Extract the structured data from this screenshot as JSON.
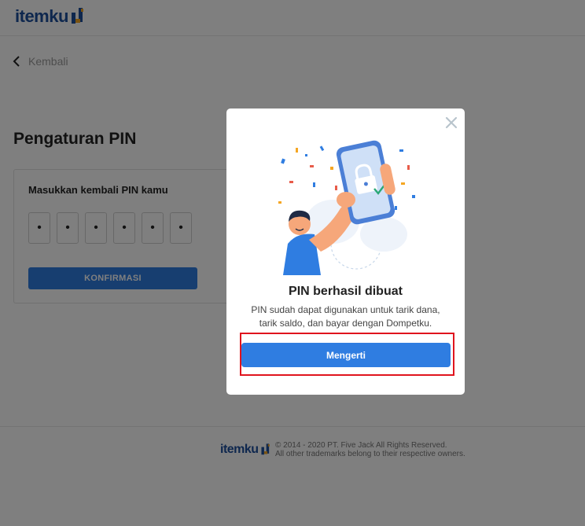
{
  "brand": {
    "name": "itemku",
    "color": "#1d4f9c",
    "accent": "#f5a623"
  },
  "nav": {
    "back_label": "Kembali"
  },
  "page": {
    "title": "Pengaturan PIN",
    "pin_label": "Masukkan kembali PIN kamu",
    "pin_digits": [
      "•",
      "•",
      "•",
      "•",
      "•",
      "•"
    ],
    "confirm_label": "KONFIRMASI"
  },
  "footer": {
    "copyright": "© 2014 - 2020 PT. Five Jack All Rights Reserved.",
    "trademark": "All other trademarks belong to their respective owners."
  },
  "modal": {
    "title": "PIN berhasil dibuat",
    "description": "PIN sudah dapat digunakan untuk tarik dana, tarik saldo, dan bayar dengan Dompetku.",
    "button_label": "Mengerti",
    "close_icon": "close-icon",
    "illustration": "success-celebration-illustration",
    "button_color": "#2f7de1",
    "highlight_color": "#e0141e"
  }
}
